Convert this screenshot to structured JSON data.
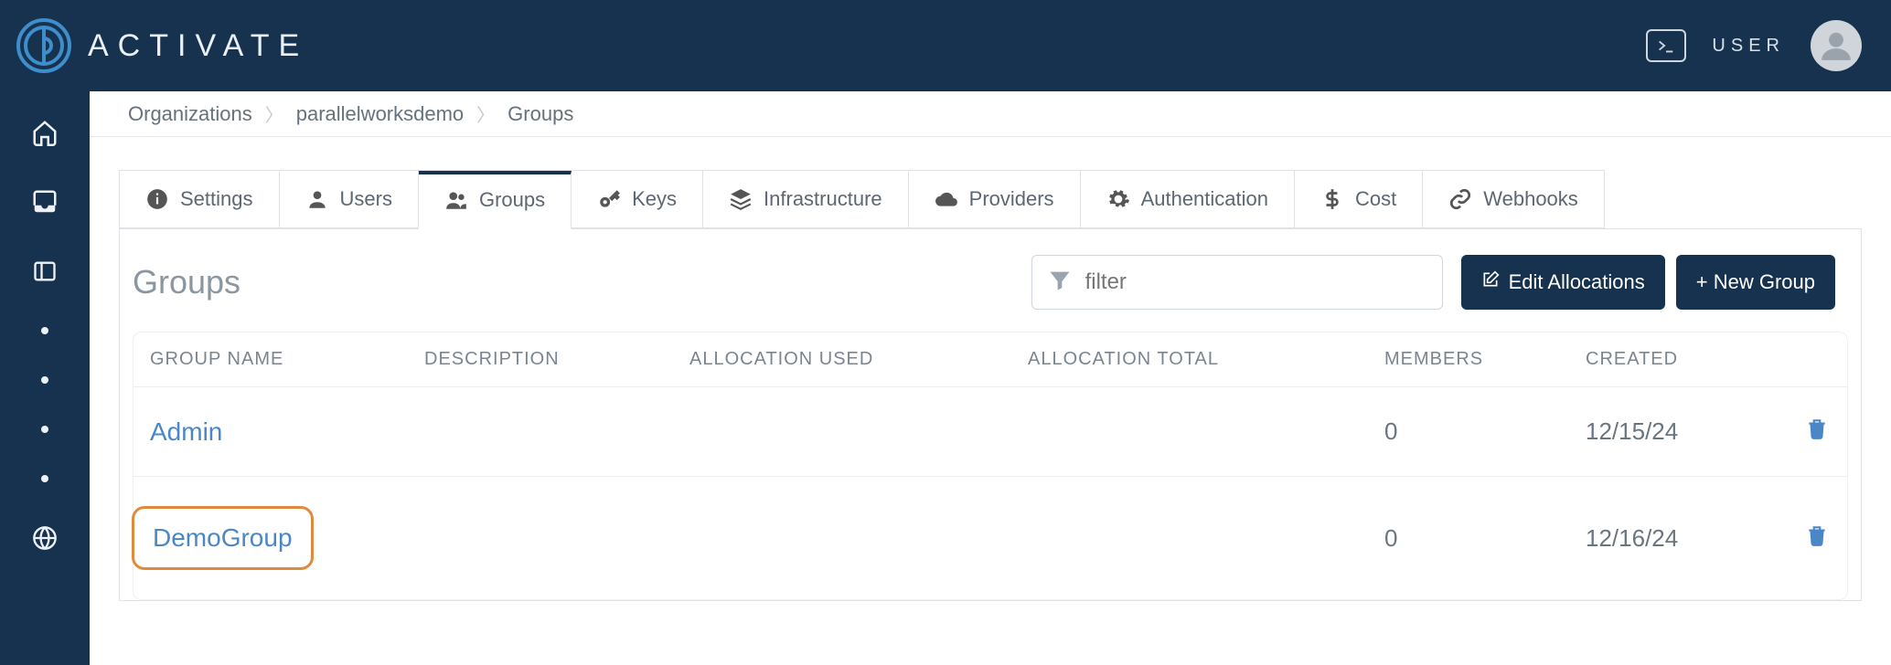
{
  "brand": {
    "name": "ACTIVATE"
  },
  "user": {
    "label": "USER"
  },
  "breadcrumbs": [
    "Organizations",
    "parallelworksdemo",
    "Groups"
  ],
  "tabs": [
    {
      "label": "Settings",
      "icon": "info"
    },
    {
      "label": "Users",
      "icon": "user"
    },
    {
      "label": "Groups",
      "icon": "users",
      "active": true
    },
    {
      "label": "Keys",
      "icon": "key"
    },
    {
      "label": "Infrastructure",
      "icon": "layers"
    },
    {
      "label": "Providers",
      "icon": "cloud"
    },
    {
      "label": "Authentication",
      "icon": "gear"
    },
    {
      "label": "Cost",
      "icon": "dollar"
    },
    {
      "label": "Webhooks",
      "icon": "link"
    }
  ],
  "panel": {
    "title": "Groups",
    "filter_placeholder": "filter",
    "edit_button": "Edit Allocations",
    "new_button": "+ New Group"
  },
  "columns": {
    "group_name": "GROUP NAME",
    "description": "DESCRIPTION",
    "alloc_used": "ALLOCATION USED",
    "alloc_total": "ALLOCATION TOTAL",
    "members": "MEMBERS",
    "created": "CREATED"
  },
  "rows": [
    {
      "name": "Admin",
      "description": "",
      "alloc_used": "",
      "alloc_total": "",
      "members": "0",
      "created": "12/15/24",
      "highlight": false
    },
    {
      "name": "DemoGroup",
      "description": "",
      "alloc_used": "",
      "alloc_total": "",
      "members": "0",
      "created": "12/16/24",
      "highlight": true
    }
  ]
}
